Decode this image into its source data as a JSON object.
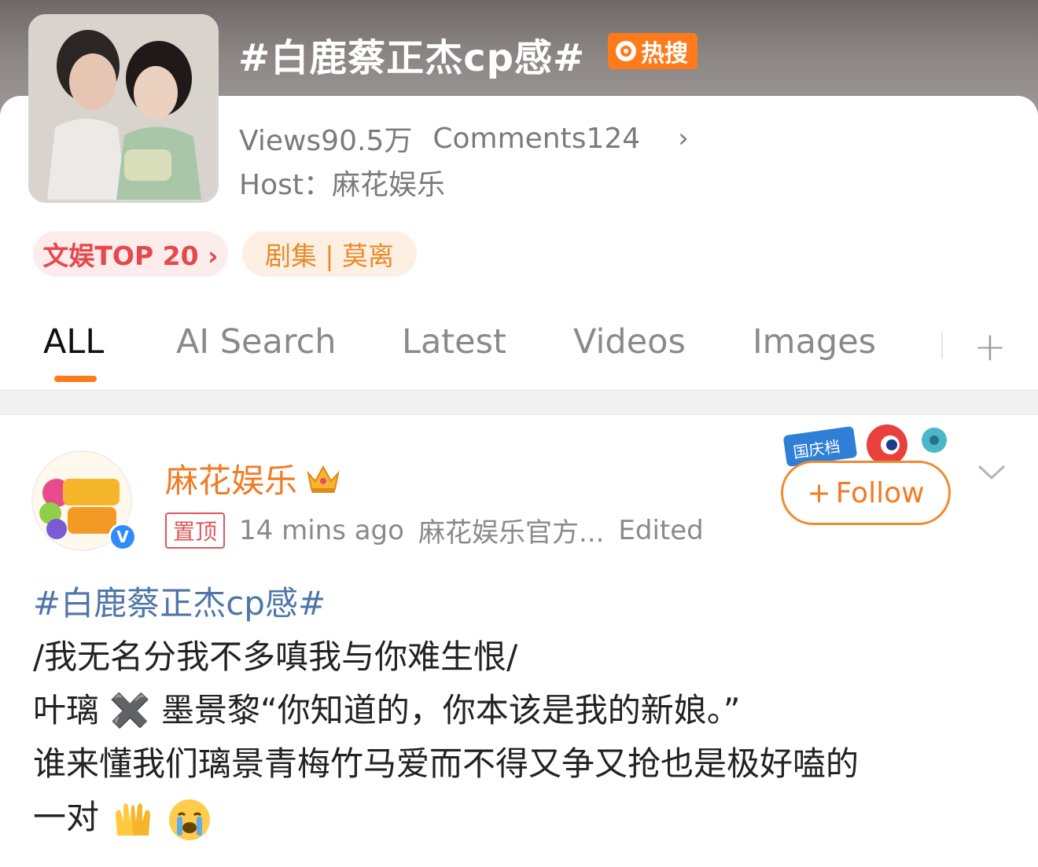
{
  "topic": {
    "title": "#白鹿蔡正杰cp感#",
    "hot_badge": "热搜",
    "views_label": "Views90.5万",
    "comments_label": "Comments124",
    "host_label": "Host：",
    "host_name": "麻花娱乐"
  },
  "tags": [
    {
      "label": "文娱TOP 20 ›"
    },
    {
      "label": "剧集 | 莫离"
    }
  ],
  "tabs": [
    {
      "label": "ALL",
      "active": true
    },
    {
      "label": "AI Search"
    },
    {
      "label": "Latest"
    },
    {
      "label": "Videos"
    },
    {
      "label": "Images"
    }
  ],
  "post": {
    "author": "麻花娱乐",
    "pin_label": "置顶",
    "time": "14 mins ago",
    "source": "麻花娱乐官方...",
    "edited": "Edited",
    "follow_label": "Follow",
    "follow_badge_text": "国庆档",
    "lines": [
      "#白鹿蔡正杰cp感#",
      "/我无名分我不多嗔我与你难生恨/",
      "叶璃 ✖️ 墨景黎“你知道的，你本该是我的新娘。”",
      "谁来懂我们璃景青梅竹马爱而不得又争又抢也是极好嗑的",
      "一对"
    ]
  },
  "colors": {
    "accent": "#ff7a1a",
    "link": "#4e76a8",
    "author": "#f07b25",
    "rank_tag": "#e5484d"
  }
}
